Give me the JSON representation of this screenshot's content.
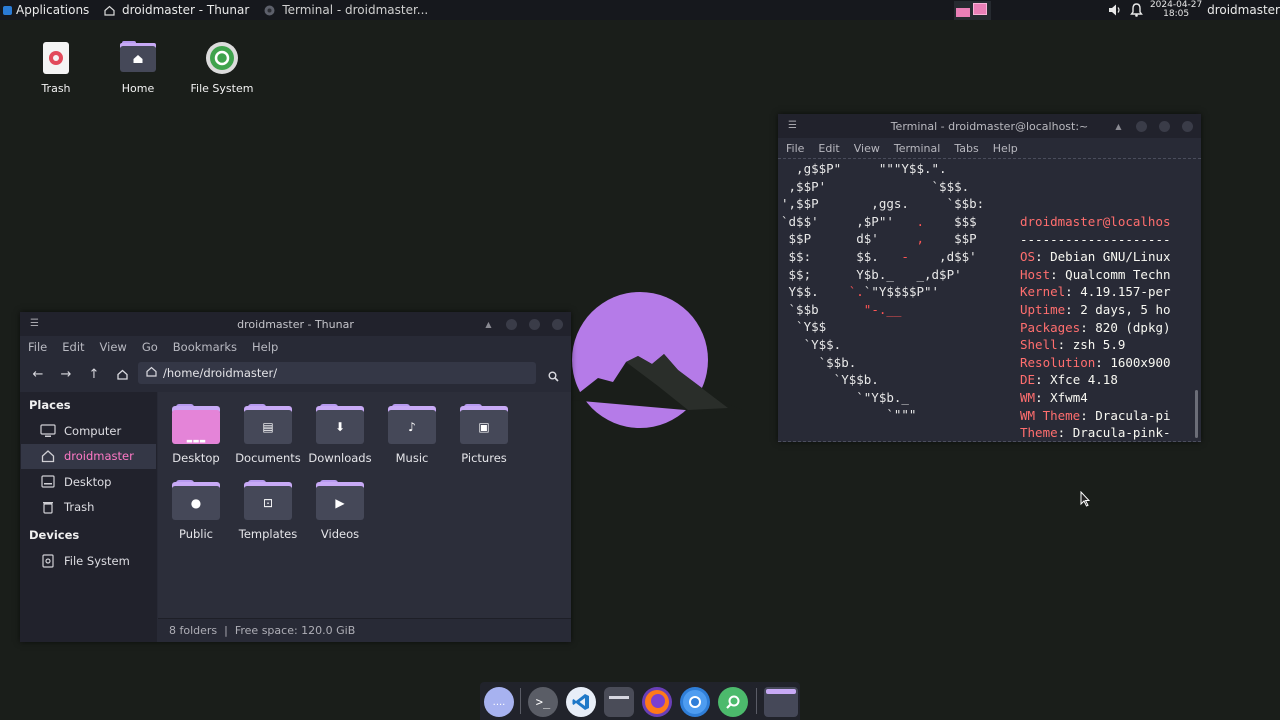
{
  "top_panel": {
    "applications_label": "Applications",
    "tasks": [
      {
        "label": "droidmaster - Thunar",
        "icon": "home-icon"
      },
      {
        "label": "Terminal - droidmaster...",
        "icon": "terminal-icon"
      }
    ],
    "clock_date": "2024-04-27",
    "clock_time": "18:05",
    "user": "droidmaster"
  },
  "desktop_icons": [
    {
      "label": "Trash",
      "icon": "trash-icon"
    },
    {
      "label": "Home",
      "icon": "home-folder-icon"
    },
    {
      "label": "File System",
      "icon": "drive-icon"
    }
  ],
  "terminal": {
    "title": "Terminal - droidmaster@localhost:~",
    "menu": [
      "File",
      "Edit",
      "View",
      "Terminal",
      "Tabs",
      "Help"
    ],
    "user_host": "droidmaster@localhos",
    "separator": "--------------------",
    "info": [
      {
        "key": "OS",
        "value": "Debian GNU/Linux"
      },
      {
        "key": "Host",
        "value": "Qualcomm Techn"
      },
      {
        "key": "Kernel",
        "value": "4.19.157-per"
      },
      {
        "key": "Uptime",
        "value": "2 days, 5 ho"
      },
      {
        "key": "Packages",
        "value": "820 (dpkg)"
      },
      {
        "key": "Shell",
        "value": "zsh 5.9"
      },
      {
        "key": "Resolution",
        "value": "1600x900"
      },
      {
        "key": "DE",
        "value": "Xfce 4.18"
      },
      {
        "key": "WM",
        "value": "Xfwm4"
      },
      {
        "key": "WM Theme",
        "value": "Dracula-pi"
      },
      {
        "key": "Theme",
        "value": "Dracula-pink-"
      }
    ]
  },
  "thunar": {
    "title": "droidmaster - Thunar",
    "menu": [
      "File",
      "Edit",
      "View",
      "Go",
      "Bookmarks",
      "Help"
    ],
    "location": "/home/droidmaster/",
    "sidebar": {
      "places_heading": "Places",
      "places": [
        {
          "label": "Computer",
          "icon": "computer-icon"
        },
        {
          "label": "droidmaster",
          "icon": "home-icon",
          "active": true
        },
        {
          "label": "Desktop",
          "icon": "desktop-icon"
        },
        {
          "label": "Trash",
          "icon": "trash-icon"
        }
      ],
      "devices_heading": "Devices",
      "devices": [
        {
          "label": "File System",
          "icon": "drive-icon"
        }
      ]
    },
    "folders": [
      {
        "label": "Desktop",
        "icon": "desktop-folder-icon"
      },
      {
        "label": "Documents",
        "icon": "documents-folder-icon"
      },
      {
        "label": "Downloads",
        "icon": "downloads-folder-icon"
      },
      {
        "label": "Music",
        "icon": "music-folder-icon"
      },
      {
        "label": "Pictures",
        "icon": "pictures-folder-icon"
      },
      {
        "label": "Public",
        "icon": "public-folder-icon"
      },
      {
        "label": "Templates",
        "icon": "templates-folder-icon"
      },
      {
        "label": "Videos",
        "icon": "videos-folder-icon"
      }
    ],
    "status": "8 folders  |  Free space: 120.0 GiB"
  },
  "dock": {
    "apps": [
      "app-grid-icon",
      "terminal-icon",
      "vscode-icon",
      "files-icon",
      "firefox-icon",
      "chromium-icon",
      "search-app-icon",
      "file-manager-icon"
    ]
  },
  "colors": {
    "accent_pink": "#ff79c6",
    "terminal_bg": "#282a36",
    "logo_purple": "#b57be8"
  }
}
